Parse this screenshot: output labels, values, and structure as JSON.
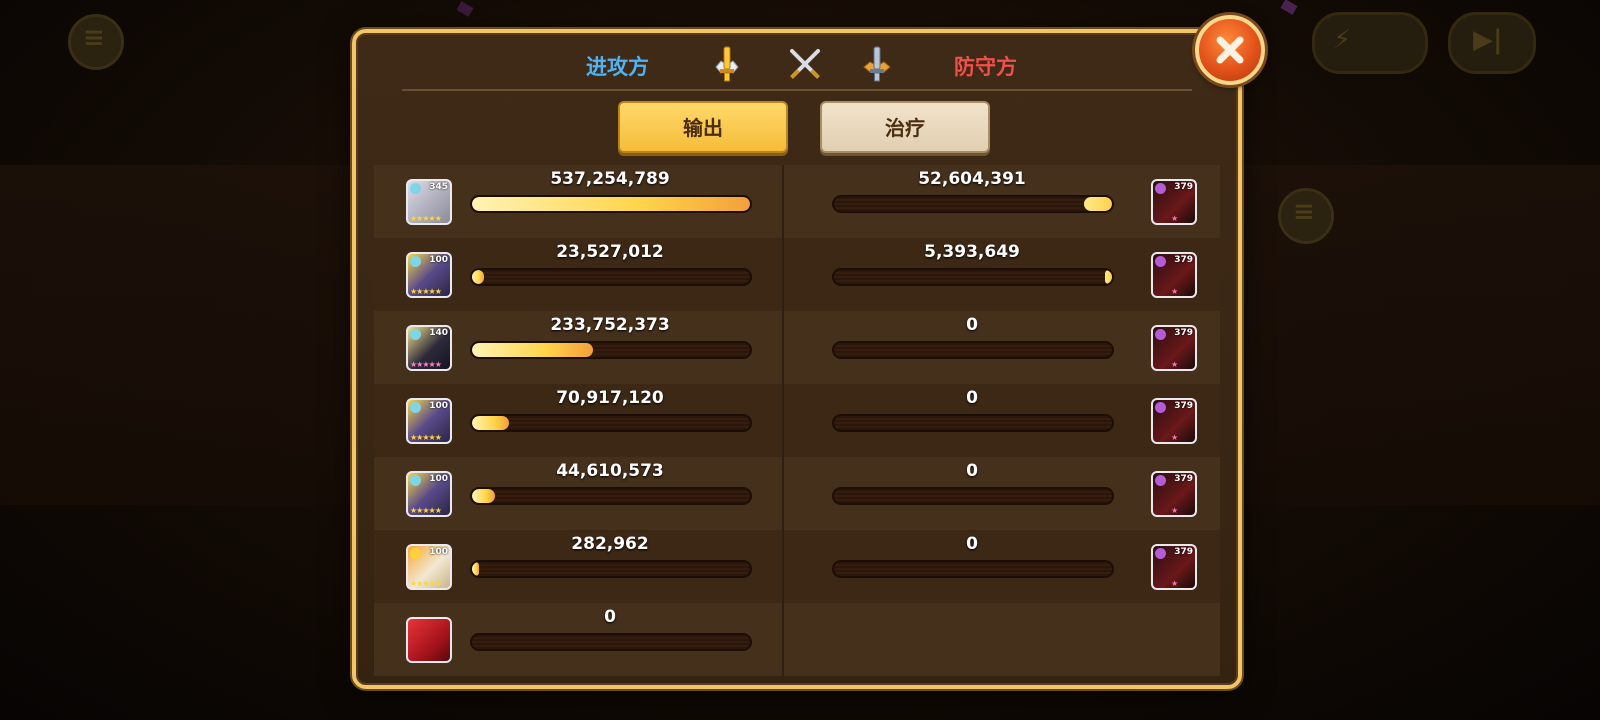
{
  "panel": {
    "attack_label": "进攻方",
    "defense_label": "防守方",
    "tabs": [
      {
        "label": "输出",
        "active": true
      },
      {
        "label": "治疗",
        "active": false
      }
    ],
    "header_icons": [
      "gold-sword-icon",
      "crossed-swords-icon",
      "silver-sword-icon"
    ],
    "close_icon": "close-icon"
  },
  "attackers": [
    {
      "value": "537,254,789",
      "level": "345",
      "fill_fraction": 1.0,
      "portrait_color": "#c9c9d2",
      "stars": "★★★★★"
    },
    {
      "value": "23,527,012",
      "level": "100",
      "fill_fraction": 0.044,
      "portrait_color": "#5a4a8a",
      "stars": "★★★★★"
    },
    {
      "value": "233,752,373",
      "level": "140",
      "fill_fraction": 0.435,
      "portrait_color": "#2d2a3a",
      "stars": "★★★★★"
    },
    {
      "value": "70,917,120",
      "level": "100",
      "fill_fraction": 0.132,
      "portrait_color": "#5a4a8a",
      "stars": "★★★★★"
    },
    {
      "value": "44,610,573",
      "level": "100",
      "fill_fraction": 0.083,
      "portrait_color": "#5a4a8a",
      "stars": "★★★★★"
    },
    {
      "value": "282,962",
      "level": "100",
      "fill_fraction": 0.0005,
      "portrait_color": "#e6d7b8",
      "stars": "★★★★★"
    },
    {
      "value": "0",
      "level": "",
      "fill_fraction": 0,
      "portrait_color": "#c0202a",
      "stars": ""
    }
  ],
  "defenders": [
    {
      "value": "52,604,391",
      "level": "379",
      "fill_fraction": 0.1,
      "stars": "★"
    },
    {
      "value": "5,393,649",
      "level": "379",
      "fill_fraction": 0.01,
      "stars": "★"
    },
    {
      "value": "0",
      "level": "379",
      "fill_fraction": 0,
      "stars": "★"
    },
    {
      "value": "0",
      "level": "379",
      "fill_fraction": 0,
      "stars": "★"
    },
    {
      "value": "0",
      "level": "379",
      "fill_fraction": 0,
      "stars": "★"
    },
    {
      "value": "0",
      "level": "379",
      "fill_fraction": 0,
      "stars": "★"
    }
  ],
  "colors": {
    "accent_gold": "#f2c566",
    "attack_blue": "#4fb4f5",
    "defense_red": "#f2504a",
    "bar_fill": "#ffd54a"
  }
}
